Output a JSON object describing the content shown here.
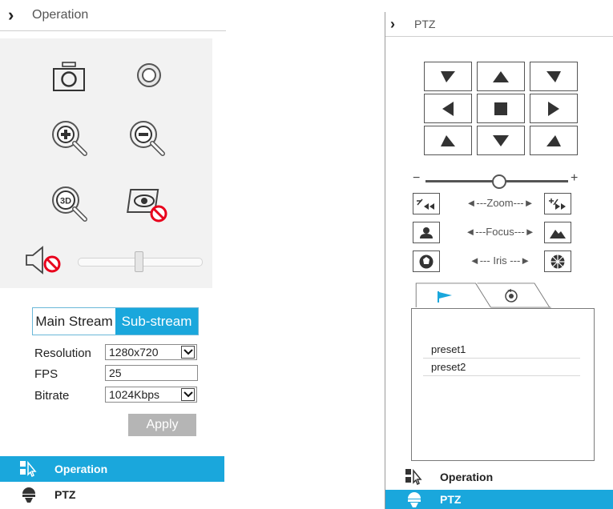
{
  "operation_panel": {
    "title": "Operation",
    "stream": {
      "main_label": "Main Stream",
      "sub_label": "Sub-stream",
      "active": "Sub-stream"
    },
    "resolution": {
      "label": "Resolution",
      "value": "1280x720"
    },
    "fps": {
      "label": "FPS",
      "value": "25"
    },
    "bitrate": {
      "label": "Bitrate",
      "value": "1024Kbps"
    },
    "apply_label": "Apply",
    "volume_level": 0.5,
    "nav": [
      {
        "label": "Operation",
        "icon": "operation-icon",
        "active": true
      },
      {
        "label": "PTZ",
        "icon": "ptz-icon",
        "active": false
      }
    ]
  },
  "ptz_panel": {
    "title": "PTZ",
    "zoom_label": "Zoom",
    "focus_label": "Focus",
    "iris_label": "Iris",
    "presets": [
      "preset1",
      "preset2"
    ],
    "nav": [
      {
        "label": "Operation",
        "icon": "operation-icon",
        "active": false
      },
      {
        "label": "PTZ",
        "icon": "ptz-icon",
        "active": true
      }
    ]
  },
  "colors": {
    "accent": "#1aa7dc",
    "apply_bg": "#b5b5b5"
  }
}
